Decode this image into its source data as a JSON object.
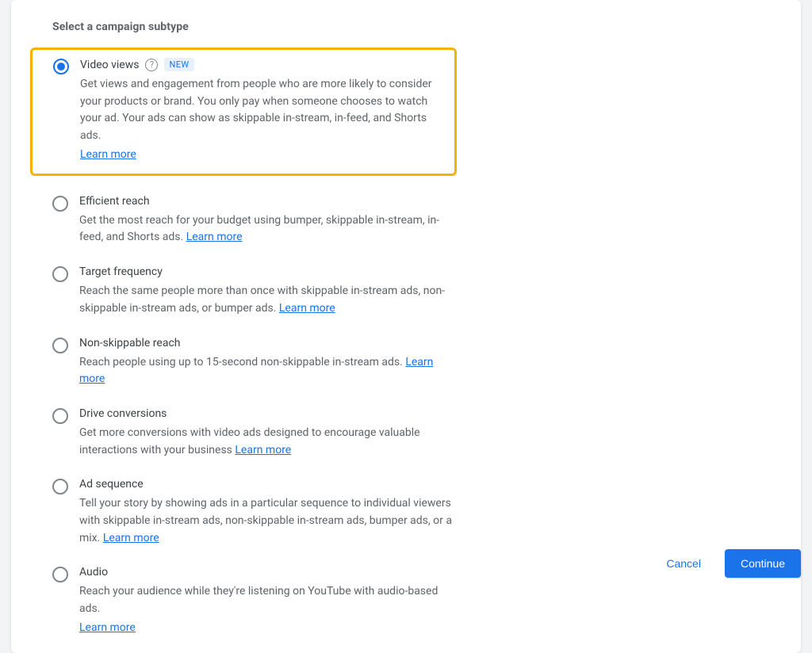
{
  "section_title": "Select a campaign subtype",
  "learn_more_label": "Learn more",
  "new_badge": "NEW",
  "options": [
    {
      "title": "Video views",
      "desc": "Get views and engagement from people who are more likely to consider your products or brand. You only pay when someone chooses to watch your ad. Your ads can show as skippable in-stream, in-feed, and Shorts ads.",
      "selected": true,
      "has_help": true,
      "has_new_badge": true,
      "learn_more_inline": false,
      "highlighted": true
    },
    {
      "title": "Efficient reach",
      "desc": "Get the most reach for your budget using bumper, skippable in-stream, in-feed, and Shorts ads.",
      "selected": false,
      "has_help": false,
      "has_new_badge": false,
      "learn_more_inline": true,
      "highlighted": false
    },
    {
      "title": "Target frequency",
      "desc": "Reach the same people more than once with skippable in-stream ads, non-skippable in-stream ads, or bumper ads.",
      "selected": false,
      "has_help": false,
      "has_new_badge": false,
      "learn_more_inline": true,
      "highlighted": false
    },
    {
      "title": "Non-skippable reach",
      "desc": "Reach people using up to 15-second non-skippable in-stream ads.",
      "selected": false,
      "has_help": false,
      "has_new_badge": false,
      "learn_more_inline": true,
      "highlighted": false
    },
    {
      "title": "Drive conversions",
      "desc": "Get more conversions with video ads designed to encourage valuable interactions with your business",
      "selected": false,
      "has_help": false,
      "has_new_badge": false,
      "learn_more_inline": true,
      "highlighted": false
    },
    {
      "title": "Ad sequence",
      "desc": "Tell your story by showing ads in a particular sequence to individual viewers with skippable in-stream ads, non-skippable in-stream ads, bumper ads, or a mix.",
      "selected": false,
      "has_help": false,
      "has_new_badge": false,
      "learn_more_inline": true,
      "highlighted": false
    },
    {
      "title": "Audio",
      "desc": "Reach your audience while they're listening on YouTube with audio-based ads.",
      "selected": false,
      "has_help": false,
      "has_new_badge": false,
      "learn_more_inline": false,
      "highlighted": false
    }
  ],
  "footer": {
    "cancel": "Cancel",
    "continue": "Continue"
  }
}
